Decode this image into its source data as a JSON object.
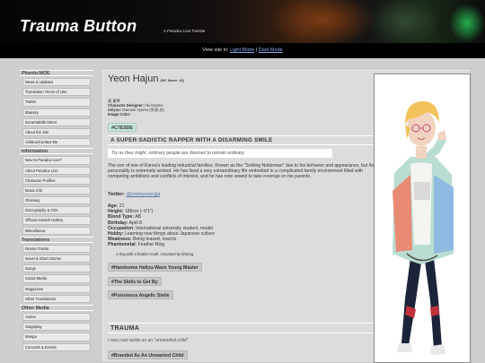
{
  "header": {
    "site_title": "Trauma Button",
    "site_subtitle": "A Paradox Live Fansite"
  },
  "viewbar": {
    "prefix": "View site in:",
    "light": "Light Mode",
    "sep": "|",
    "dark": "Dark Mode"
  },
  "sidebar": {
    "sections": [
      {
        "title": "Phanto.MOE",
        "items": [
          "News & Updates",
          "Translation Terms of Use",
          "Twitter",
          "Bluesky",
          "DreamWidth Mirror",
          "About the Site",
          "Askbox/Contact Me"
        ]
      },
      {
        "title": "Information",
        "items": [
          "New to Paradox Live?",
          "About Paradox Live",
          "Character Profiles",
          "Music Info",
          "Glossary",
          "Discography & CDs",
          "Official Artwork Gallery",
          "Miscellanea"
        ]
      },
      {
        "title": "Translations",
        "items": [
          "Drama Tracks",
          "Novel & Short Stories",
          "Songs",
          "Social Media",
          "Magazines",
          "Other Translations"
        ]
      },
      {
        "title": "Other Media",
        "items": [
          "Anime",
          "Stageplay",
          "Manga",
          "Concerts & Events"
        ]
      }
    ]
  },
  "profile": {
    "name": "Yeon Hajun",
    "name_note": "(MC Name: 4§)",
    "korean": "燕 夏準",
    "designer_label": "Character Designer:",
    "designer": "Aki Aizome",
    "seiyuu_label": "Seiyuu:",
    "seiyuu": "Munose Ayumu (宗清 歩)",
    "color_label": "Image Color:",
    "color_hex": "#C7E5DE",
    "headline": "A SUPER-SADISTIC RAPPER WITH A DISARMING SMILE",
    "quote": "Try as they might, ordinary people are doomed to remain ordinary.",
    "description": "The son of one of Korea's leading industrial families. Known as the \"Smiling Nobleman\" due to his behavior and appearance, but his personality is extremely wicked. He has lived a very extraordinary life embroiled in a complicated family environment filled with competing ambitions and conflicts of interest, and he has now vowed to take revenge on his parents.",
    "twitter_label": "Twitter:",
    "twitter_handle": "@smileywangja",
    "stats": [
      {
        "label": "Age:",
        "value": "21"
      },
      {
        "label": "Height:",
        "value": "185cm (~6'1\")"
      },
      {
        "label": "Blood Type:",
        "value": "AB"
      },
      {
        "label": "Birthday:",
        "value": "April 8"
      },
      {
        "label": "Occupation:",
        "value": "International university student, model"
      },
      {
        "label": "Hobby:",
        "value": "Learning new things about Japanese culture"
      },
      {
        "label": "Weakness:",
        "value": "Being teased, insects"
      },
      {
        "label": "Phantometal:",
        "value": "Feather Ring"
      }
    ],
    "phantometal_desc": "A ring with a feather motif. Activated by kissing.",
    "tags": [
      "#Handsome Hallyu-Wave Young Master",
      "#The Skills to Get By",
      "#Poisonous Angelic Smile"
    ],
    "trauma_title": "TRAUMA",
    "trauma_quote": "I was cast aside as an \"unneeded child\"",
    "trauma_tag": "#Branded As An Unwanted Child"
  },
  "colors": {
    "accent": "#C7E5DE",
    "hair": "#f2c35a",
    "jacket": "#b9ddd2",
    "pants": "#1b2438"
  }
}
